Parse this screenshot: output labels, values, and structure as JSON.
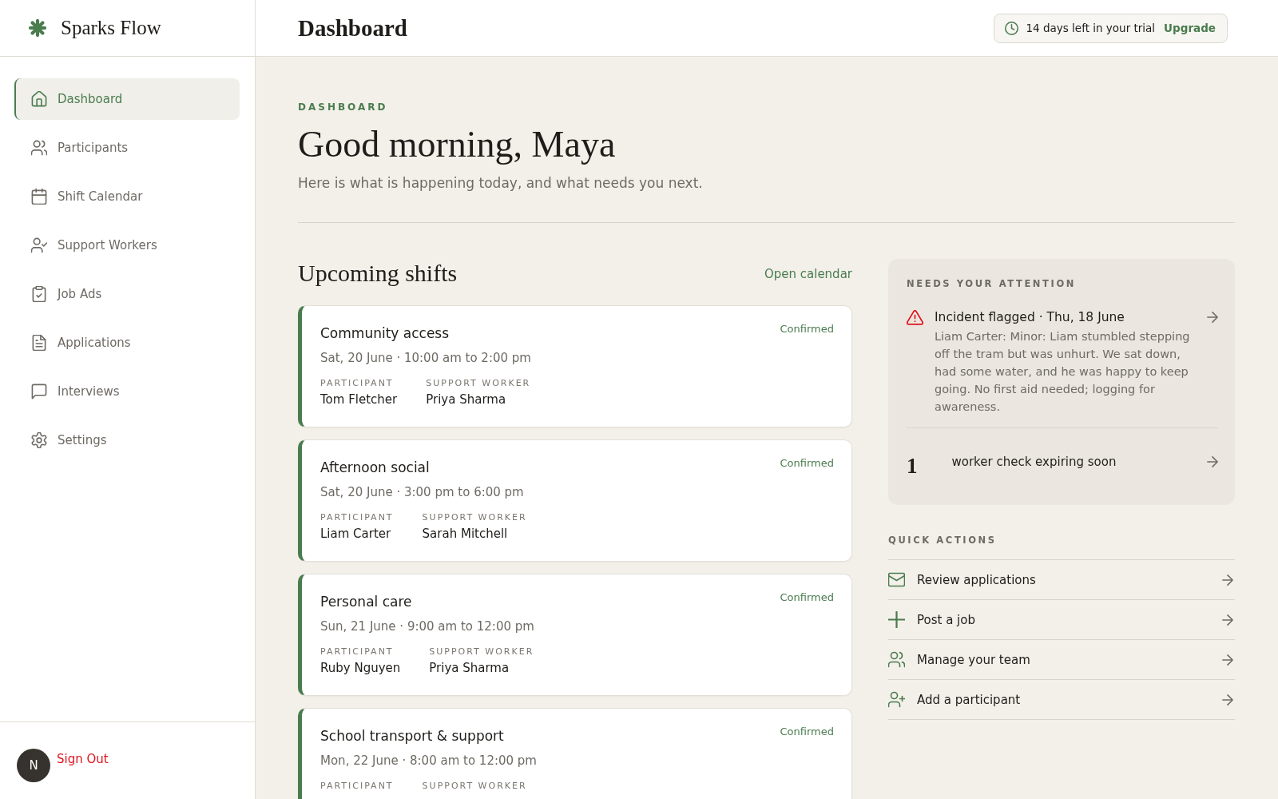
{
  "sidebar": {
    "brand": "Sparks Flow",
    "items": [
      {
        "label": "Dashboard",
        "selected": true
      },
      {
        "label": "Participants",
        "selected": false
      },
      {
        "label": "Shift Calendar",
        "selected": false
      },
      {
        "label": "Support Workers",
        "selected": false
      },
      {
        "label": "Job Ads",
        "selected": false
      },
      {
        "label": "Applications",
        "selected": false
      },
      {
        "label": "Interviews",
        "selected": false
      },
      {
        "label": "Settings",
        "selected": false
      }
    ],
    "user": {
      "initial": "N",
      "sign_out": "Sign Out"
    }
  },
  "header": {
    "title": "Dashboard",
    "trial": {
      "text": "14 days left in your trial",
      "action": "Upgrade"
    }
  },
  "intro": {
    "eyebrow": "DASHBOARD",
    "greeting": "Good morning, Maya",
    "subtitle": "Here is what is happening today, and what needs you next."
  },
  "shifts": {
    "title": "Upcoming shifts",
    "link": "Open calendar",
    "cards": [
      {
        "title": "Community access",
        "status": "Confirmed",
        "when": "Sat, 20 June · 10:00 am to 2:00 pm",
        "fields": [
          {
            "label": "PARTICIPANT",
            "value": "Tom Fletcher"
          },
          {
            "label": "SUPPORT WORKER",
            "value": "Priya Sharma"
          }
        ]
      },
      {
        "title": "Afternoon social",
        "status": "Confirmed",
        "when": "Sat, 20 June · 3:00 pm to 6:00 pm",
        "fields": [
          {
            "label": "PARTICIPANT",
            "value": "Liam Carter"
          },
          {
            "label": "SUPPORT WORKER",
            "value": "Sarah Mitchell"
          }
        ]
      },
      {
        "title": "Personal care",
        "status": "Confirmed",
        "when": "Sun, 21 June · 9:00 am to 12:00 pm",
        "fields": [
          {
            "label": "PARTICIPANT",
            "value": "Ruby Nguyen"
          },
          {
            "label": "SUPPORT WORKER",
            "value": "Priya Sharma"
          }
        ]
      },
      {
        "title": "School transport & support",
        "status": "Confirmed",
        "when": "Mon, 22 June · 8:00 am to 12:00 pm",
        "fields": [
          {
            "label": "PARTICIPANT"
          },
          {
            "label": "SUPPORT WORKER"
          }
        ]
      }
    ]
  },
  "attention": {
    "heading": "NEEDS YOUR ATTENTION",
    "items": [
      {
        "kind": "incident",
        "title": "Incident flagged · Thu, 18 June",
        "body": "Liam Carter: Minor: Liam stumbled stepping off the tram but was unhurt. We sat down, had some water, and he was happy to keep going. No first aid needed; logging for awareness."
      },
      {
        "kind": "count",
        "count": "1",
        "text": "worker check expiring soon"
      }
    ]
  },
  "quick_actions": {
    "heading": "QUICK ACTIONS",
    "items": [
      {
        "label": "Review applications"
      },
      {
        "label": "Post a job"
      },
      {
        "label": "Manage your team"
      },
      {
        "label": "Add a participant"
      }
    ]
  }
}
